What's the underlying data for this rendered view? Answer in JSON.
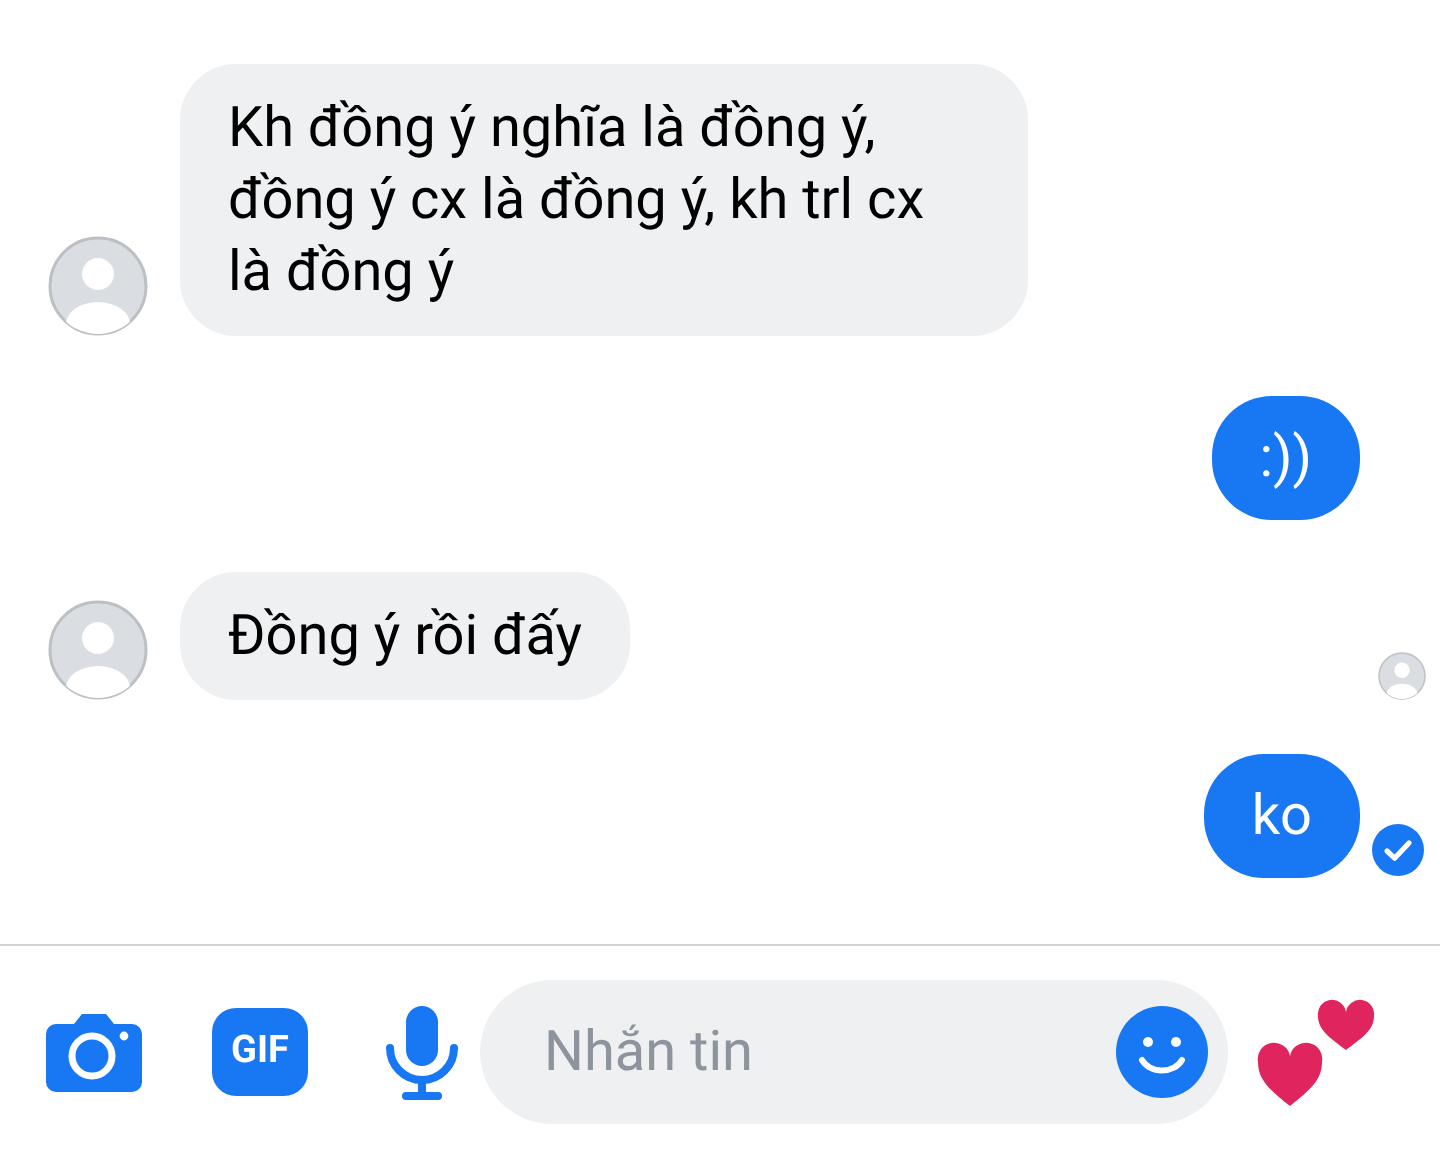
{
  "messages": [
    {
      "kind": "incoming",
      "text": "Kh đồng ý nghĩa là đồng ý, đồng ý cx là đồng ý, kh trl cx là đồng ý"
    },
    {
      "kind": "outgoing",
      "text": ":))",
      "delivered": false
    },
    {
      "kind": "incoming",
      "text": "Đồng ý rồi đấy"
    },
    {
      "kind": "seen"
    },
    {
      "kind": "outgoing",
      "text": "ko",
      "delivered": true
    }
  ],
  "composer": {
    "gif_label": "GIF",
    "placeholder": "Nhắn tin"
  }
}
